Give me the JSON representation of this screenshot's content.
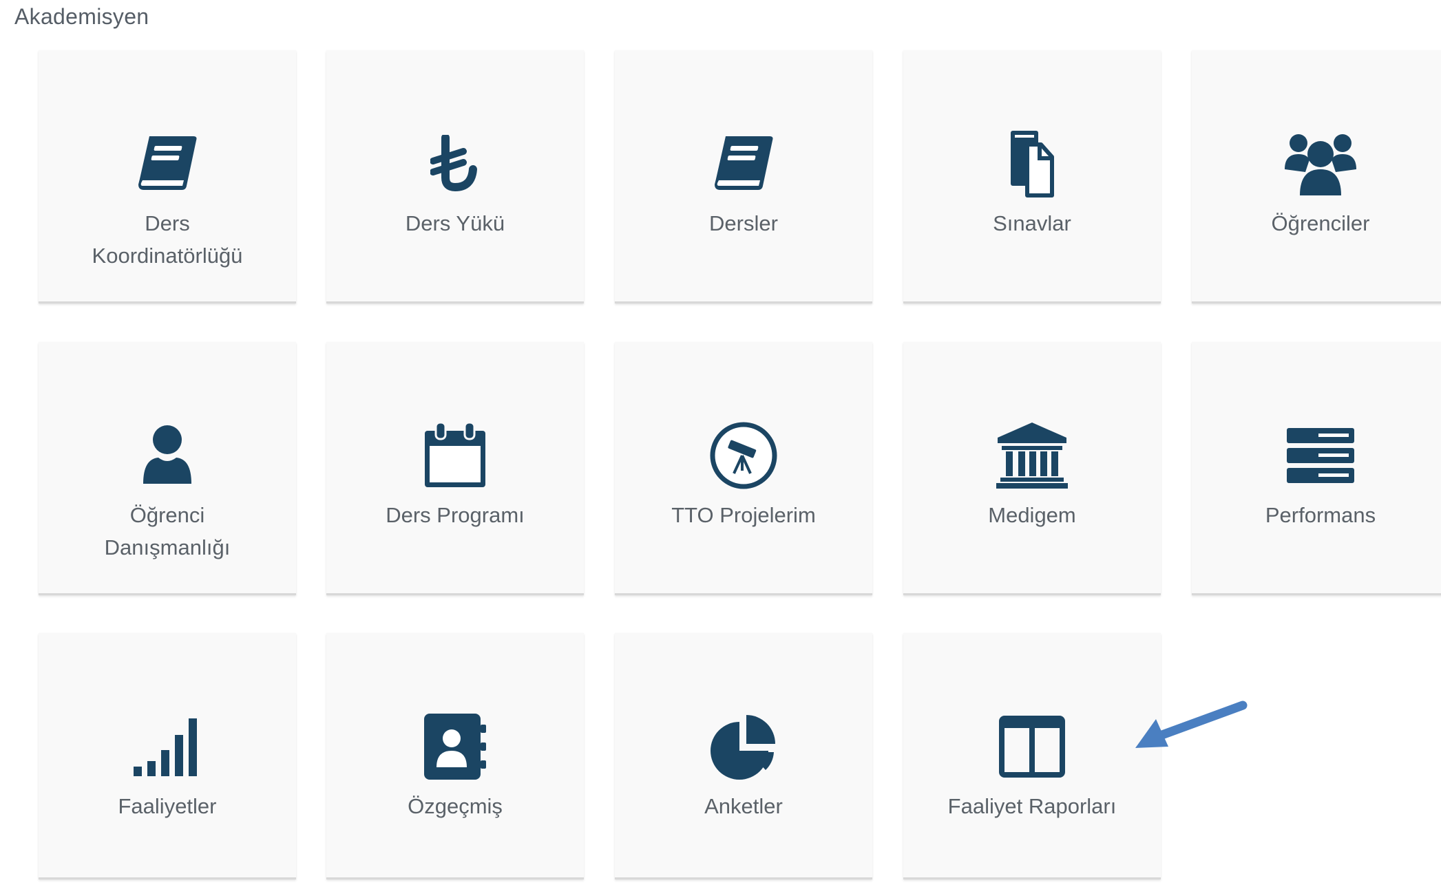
{
  "section": {
    "title": "Akademisyen"
  },
  "colors": {
    "icon": "#1b4563",
    "label": "#5a6168",
    "tile_bg": "#f9f9f9",
    "arrow": "#4a7fc1"
  },
  "tiles": [
    {
      "label": "Ders\nKoordinatörlüğü",
      "icon": "book-icon"
    },
    {
      "label": "Ders Yükü",
      "icon": "lira-icon"
    },
    {
      "label": "Dersler",
      "icon": "book-icon"
    },
    {
      "label": "Sınavlar",
      "icon": "documents-icon"
    },
    {
      "label": "Öğrenciler",
      "icon": "users-icon"
    },
    {
      "label": "Öğrenci\nDanışmanlığı",
      "icon": "user-icon"
    },
    {
      "label": "Ders Programı",
      "icon": "calendar-icon"
    },
    {
      "label": "TTO Projelerim",
      "icon": "telescope-icon"
    },
    {
      "label": "Medigem",
      "icon": "institution-icon"
    },
    {
      "label": "Performans",
      "icon": "server-icon"
    },
    {
      "label": "Faaliyetler",
      "icon": "signal-icon"
    },
    {
      "label": "Özgeçmiş",
      "icon": "address-book-icon"
    },
    {
      "label": "Anketler",
      "icon": "pie-chart-icon"
    },
    {
      "label": "Faaliyet Raporları",
      "icon": "columns-icon"
    }
  ]
}
